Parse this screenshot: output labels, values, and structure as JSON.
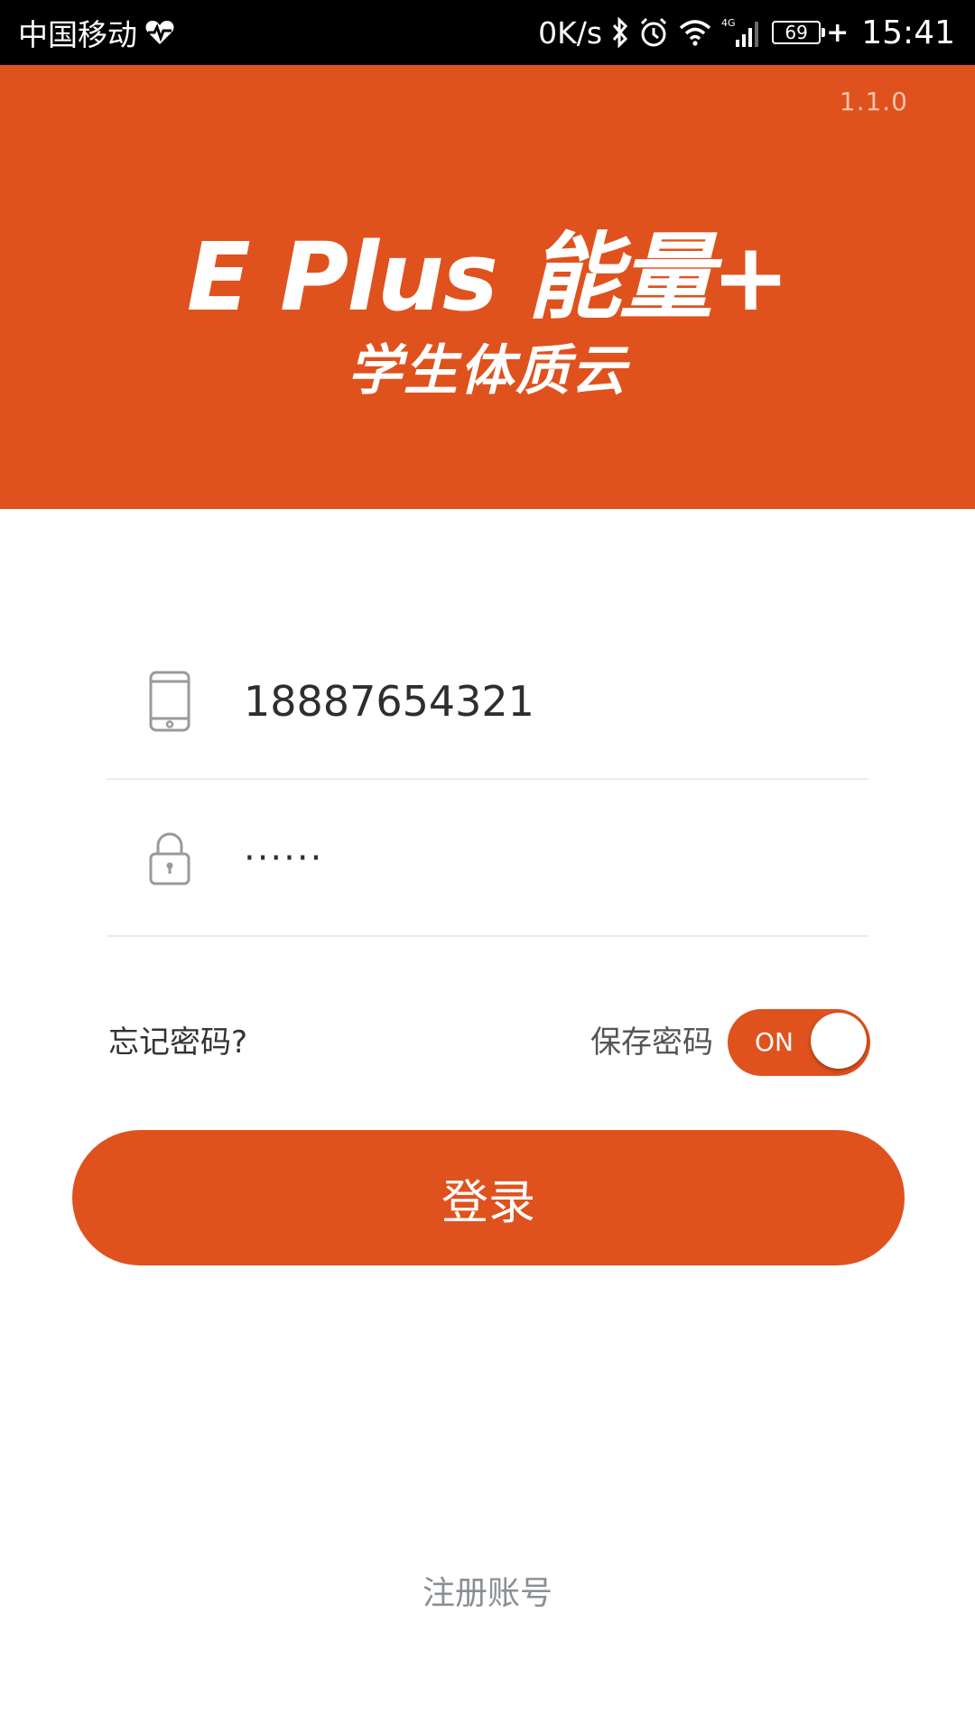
{
  "status_bar": {
    "carrier": "中国移动",
    "net_speed": "0K/s",
    "network_type": "4G",
    "battery": "69",
    "time": "15:41",
    "icons": [
      "heart-rate-icon",
      "bluetooth-icon",
      "alarm-icon",
      "wifi-icon",
      "signal-icon",
      "battery-icon"
    ]
  },
  "header": {
    "version": "1.1.0",
    "logo_line1": "E Plus 能量+",
    "logo_line2": "学生体质云"
  },
  "form": {
    "phone_value": "18887654321",
    "phone_icon": "mobile-phone-icon",
    "password_value": "······",
    "password_icon": "lock-icon",
    "forgot_password": "忘记密码?",
    "save_password_label": "保存密码",
    "save_toggle_text": "ON",
    "login_button": "登录",
    "register_link": "注册账号"
  },
  "colors": {
    "brand": "#df521e",
    "status_bar": "#000000"
  }
}
